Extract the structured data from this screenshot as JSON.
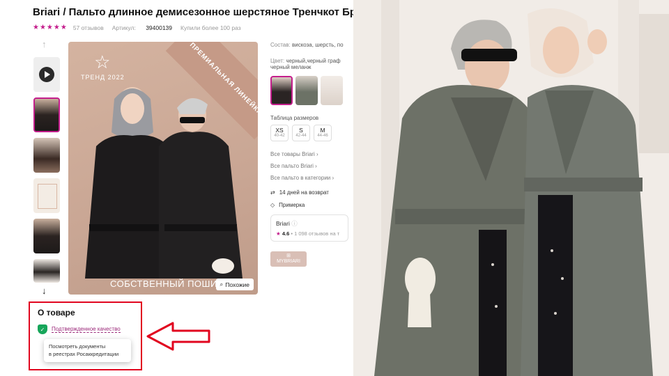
{
  "product": {
    "title": "Briari / Пальто длинное демисезонное шерстяное Тренчкот Бриари",
    "stars": "★★★★★",
    "reviews": "57 отзывов",
    "article_label": "Артикул:",
    "article_value": "39400139",
    "bought": "Купили более 100 раз"
  },
  "hero": {
    "ribbon": "ПРЕМИАЛЬНАЯ ЛИНЕЙКА",
    "trend": "ТРЕНД 2022",
    "caption": "СОБСТВЕННЫЙ ПОШИ",
    "similar_label": "Похожие"
  },
  "info": {
    "composition_label": "Состав:",
    "composition_value": "вискоза, шерсть, по",
    "color_label": "Цвет:",
    "color_value": "черный,черный граф",
    "color_value2": "черный меланж",
    "sizes_label": "Таблица размеров",
    "sizes": [
      {
        "name": "XS",
        "range": "40-42"
      },
      {
        "name": "S",
        "range": "42-44"
      },
      {
        "name": "M",
        "range": "44-46"
      }
    ],
    "links": [
      "Все товары Briari ›",
      "Все пальто Briari ›",
      "Все пальто в категории ›"
    ],
    "return_label": "14 дней на возврат",
    "fitting_label": "Примерка",
    "seller_name": "Briari",
    "seller_rating": "4.6",
    "seller_reviews": "• 1 098 отзывов на т",
    "mybriari": "MYBRIARI"
  },
  "about": {
    "title": "О товаре",
    "quality_link": "Подтвержденное качество",
    "tooltip_line1": "Посмотреть документы",
    "tooltip_line2": "в реестрах Росаккредитации"
  },
  "colors": {
    "accent": "#c41e8c",
    "highlight_red": "#e1061f",
    "verified_green": "#17a65a"
  }
}
